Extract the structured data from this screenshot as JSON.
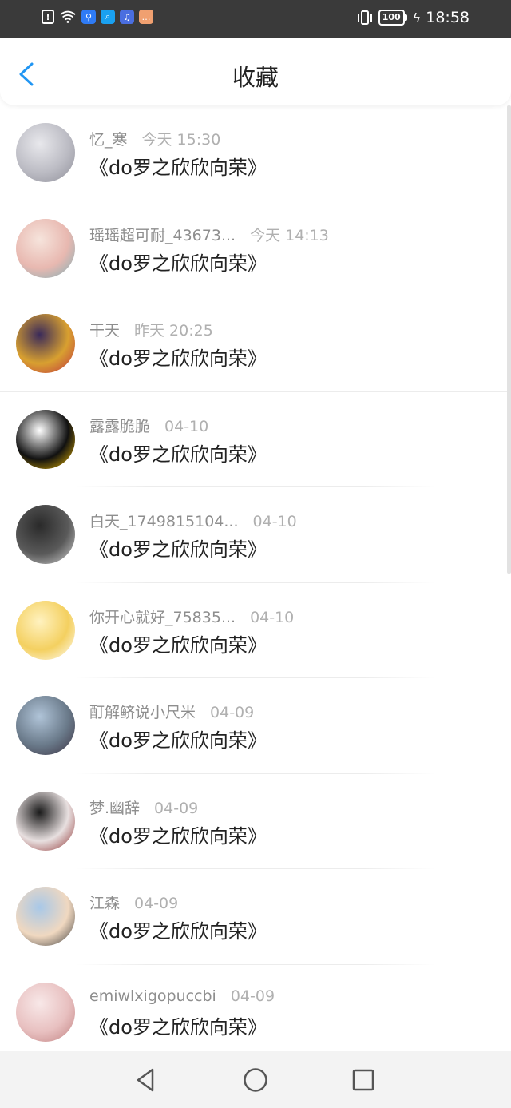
{
  "status_bar": {
    "time": "18:58",
    "battery": "100",
    "left_icons": [
      "alert-icon",
      "wifi-icon",
      "app-icon-1",
      "app-icon-2",
      "music-icon",
      "message-icon"
    ],
    "colors": {
      "app1": "#2f7bf5",
      "app2": "#1aa1f0",
      "app3": "#4a6ee0",
      "app4": "#f0a070"
    }
  },
  "header": {
    "title": "收藏"
  },
  "accent_color": "#2196f3",
  "items": [
    {
      "name": "忆_寒",
      "time": "今天 15:30",
      "content": "《do罗之欣欣向荣》",
      "avatar_colors": [
        "#e8e8ec",
        "#bcbcc4",
        "#8e8e98"
      ]
    },
    {
      "name": "瑶瑶超可耐_43673...",
      "time": "今天 14:13",
      "content": "《do罗之欣欣向荣》",
      "avatar_colors": [
        "#f6e4dc",
        "#e8b8b0",
        "#7ab0b8"
      ]
    },
    {
      "name": "干天",
      "time": "昨天 20:25",
      "content": "《do罗之欣欣向荣》",
      "avatar_colors": [
        "#3a2a5a",
        "#d8a030",
        "#c03040"
      ]
    },
    {
      "name": "露露脆脆",
      "time": "04-10",
      "content": "《do罗之欣欣向荣》",
      "avatar_colors": [
        "#ffffff",
        "#111111",
        "#f5c000"
      ]
    },
    {
      "name": "白天_1749815104...",
      "time": "04-10",
      "content": "《do罗之欣欣向荣》",
      "avatar_colors": [
        "#2a2a2a",
        "#5a5a5a",
        "#d8d8d8"
      ]
    },
    {
      "name": "你开心就好_75835...",
      "time": "04-10",
      "content": "《do罗之欣欣向荣》",
      "avatar_colors": [
        "#fff2c0",
        "#f4d060",
        "#ffffff"
      ]
    },
    {
      "name": "酊解鲚说小尺米",
      "time": "04-09",
      "content": "《do罗之欣欣向荣》",
      "avatar_colors": [
        "#b0c4d8",
        "#6a7a8a",
        "#3a3040"
      ]
    },
    {
      "name": "梦.幽辞",
      "time": "04-09",
      "content": "《do罗之欣欣向荣》",
      "avatar_colors": [
        "#1a1a1a",
        "#e8e0e0",
        "#8a2a2a"
      ]
    },
    {
      "name": "江森",
      "time": "04-09",
      "content": "《do罗之欣欣向荣》",
      "avatar_colors": [
        "#a8c8e8",
        "#f0d8c0",
        "#3a3a3a"
      ]
    },
    {
      "name": "emiwlxigopuccbi",
      "time": "04-09",
      "content": "《do罗之欣欣向荣》",
      "avatar_colors": [
        "#f8e8e8",
        "#e8c0c0",
        "#c08080"
      ]
    }
  ],
  "nav": [
    "back-triangle-icon",
    "home-circle-icon",
    "recents-square-icon"
  ]
}
